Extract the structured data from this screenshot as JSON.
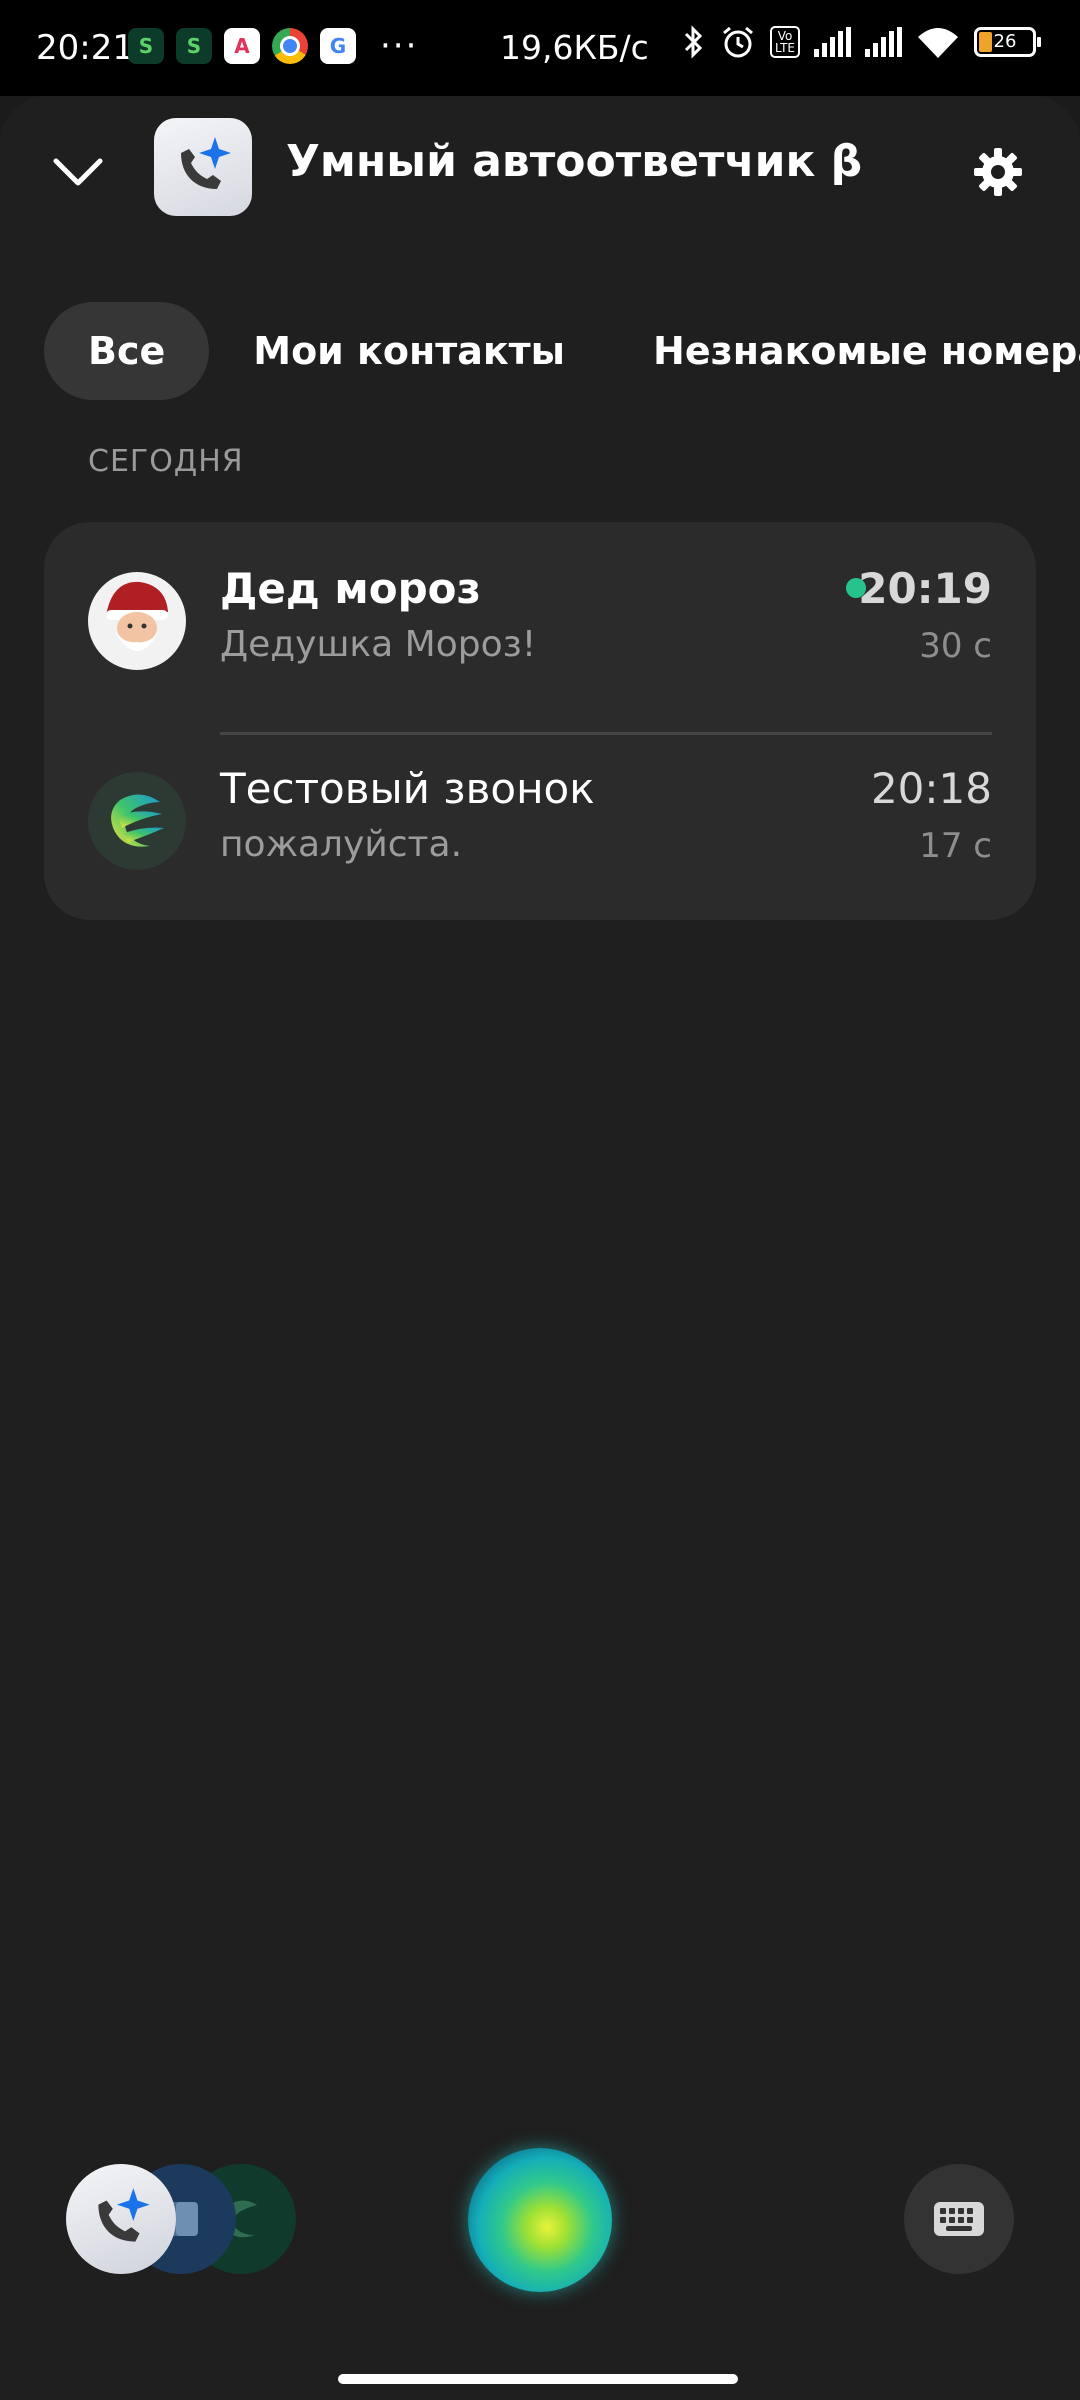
{
  "status_bar": {
    "time": "20:21",
    "speed": "19,6КБ/с",
    "battery_level": "26",
    "notification_icons": [
      "sber-icon",
      "sber-icon",
      "gosuslugi-icon",
      "chrome-icon",
      "google-icon"
    ],
    "more": "···"
  },
  "header": {
    "title": "Умный автоответчик β",
    "collapse_icon": "chevron-down-icon",
    "settings_icon": "gear-icon"
  },
  "tabs": [
    {
      "label": "Все",
      "active": true
    },
    {
      "label": "Мои контакты",
      "active": false
    },
    {
      "label": "Незнакомые номера",
      "active": false
    }
  ],
  "section": {
    "label": "СЕГОДНЯ"
  },
  "calls": [
    {
      "name": "Дед мороз",
      "preview": "Дедушка Мороз!",
      "time": "20:19",
      "duration": "30 с",
      "unread": true,
      "avatar": "santa-avatar"
    },
    {
      "name": "Тестовый звонок",
      "preview": "пожалуйста.",
      "time": "20:18",
      "duration": "17 с",
      "unread": false,
      "avatar": "sber-avatar"
    }
  ],
  "colors": {
    "background": "#1b1b1b",
    "card": "#2b2b2b",
    "active_tab": "#363636",
    "unread_dot": "#27c38c",
    "accent": "#1a73e8"
  }
}
